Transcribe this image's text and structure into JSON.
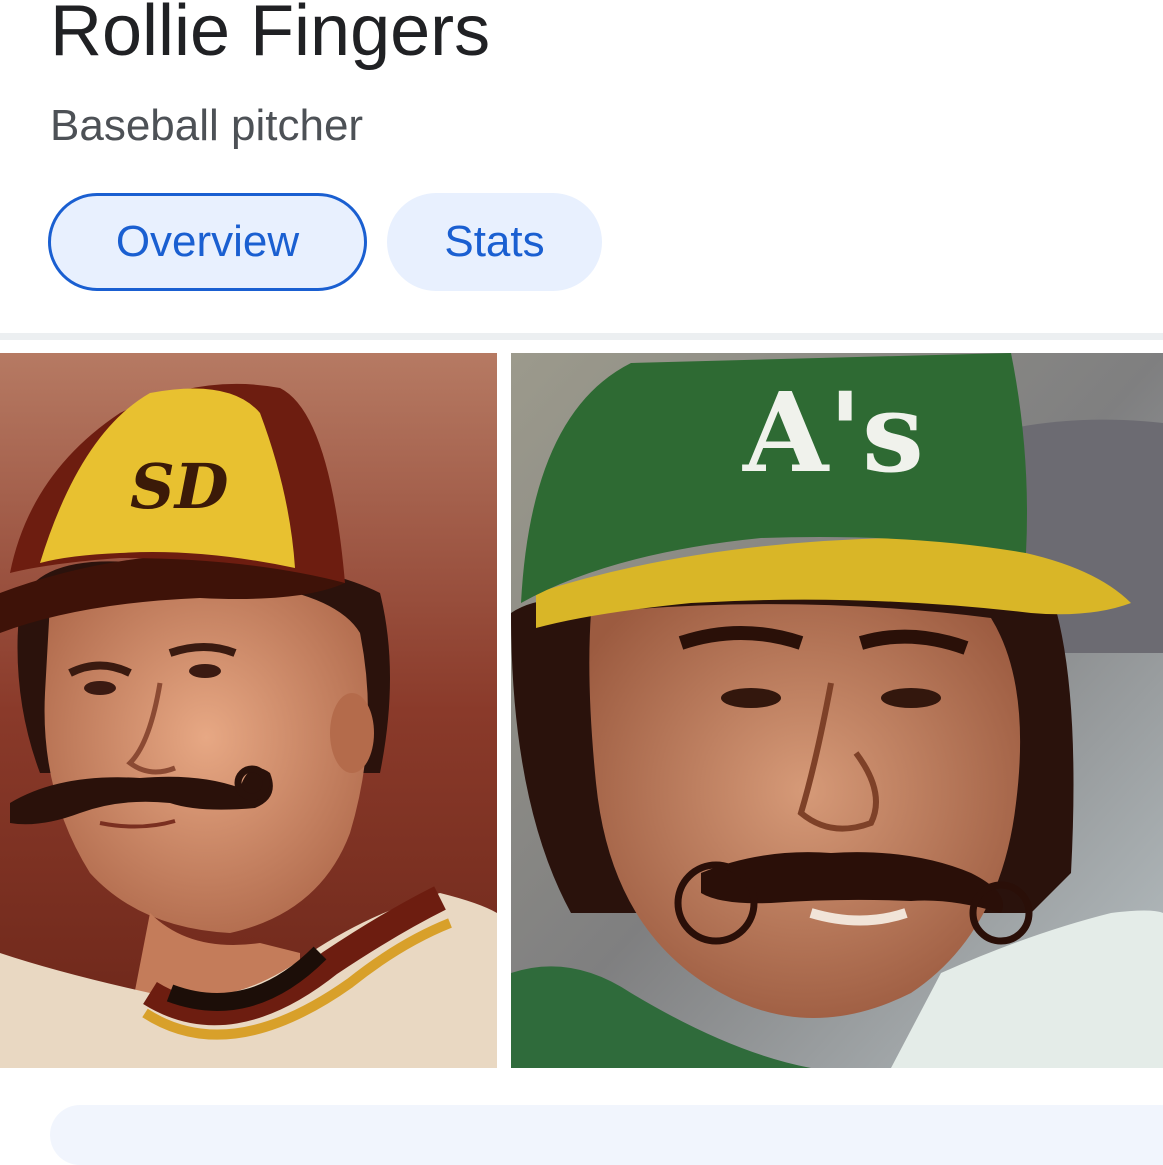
{
  "header": {
    "title": "Rollie Fingers",
    "subtitle": "Baseball pitcher"
  },
  "tabs": [
    {
      "label": "Overview",
      "selected": true
    },
    {
      "label": "Stats",
      "selected": false
    }
  ],
  "colors": {
    "accent": "#1a5fd1",
    "chip_bg": "#e8f0fe",
    "title": "#202124",
    "subtitle": "#4d5156"
  },
  "images": [
    {
      "logo_text": "SD"
    },
    {
      "logo_text": "A's"
    }
  ]
}
